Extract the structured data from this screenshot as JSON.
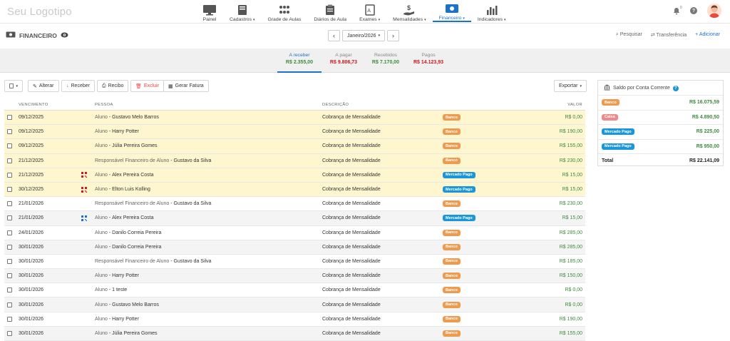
{
  "app": {
    "logo": "Seu Logotipo"
  },
  "nav": [
    {
      "label": "Painel",
      "icon": "monitor-icon",
      "caret": false,
      "active": false
    },
    {
      "label": "Cadastros",
      "icon": "book-icon",
      "caret": true,
      "active": false
    },
    {
      "label": "Grade de Aulas",
      "icon": "people-grid-icon",
      "caret": false,
      "active": false
    },
    {
      "label": "Diários de Aula",
      "icon": "clipboard-icon",
      "caret": false,
      "active": false
    },
    {
      "label": "Exames",
      "icon": "exam-icon",
      "caret": true,
      "active": false
    },
    {
      "label": "Mensalidades",
      "icon": "hand-money-icon",
      "caret": true,
      "active": false
    },
    {
      "label": "Financeiro",
      "icon": "banknote-icon",
      "caret": true,
      "active": true
    },
    {
      "label": "Indicadores",
      "icon": "bar-chart-icon",
      "caret": true,
      "active": false
    }
  ],
  "notifications": {
    "count": "0"
  },
  "page": {
    "title": "FINANCEIRO"
  },
  "month_selector": {
    "value": "Janeiro/2026",
    "prev": "‹",
    "next": "›"
  },
  "header_actions": {
    "search": "Pesquisar",
    "transfer": "Transferência",
    "add": "Adicionar"
  },
  "summary_tabs": [
    {
      "label": "A receber",
      "amount": "R$ 2.355,00",
      "color": "green",
      "active": true
    },
    {
      "label": "A pagar",
      "amount": "R$ 9.806,73",
      "color": "red",
      "active": false
    },
    {
      "label": "Recebidos",
      "amount": "R$ 7.170,00",
      "color": "green",
      "active": false
    },
    {
      "label": "Pagos",
      "amount": "R$ 14.123,93",
      "color": "red",
      "active": false
    }
  ],
  "toolbar": {
    "alter": "Alterar",
    "receive": "Receber",
    "receipt": "Recibo",
    "delete": "Excluir",
    "invoice": "Gerar Fatura",
    "export": "Exportar"
  },
  "table": {
    "headers": {
      "due": "VENCIMENTO",
      "person": "PESSOA",
      "description": "DESCRIÇÃO",
      "value": "VALOR"
    },
    "rows": [
      {
        "date": "09/12/2025",
        "role": "Aluno",
        "name": "Gustavo Melo Barros",
        "desc": "Cobrança de Mensalidade",
        "account": "Banco",
        "value": "R$ 0,00",
        "highlight": true,
        "qr": false
      },
      {
        "date": "09/12/2025",
        "role": "Aluno",
        "name": "Harry Potter",
        "desc": "Cobrança de Mensalidade",
        "account": "Banco",
        "value": "R$ 190,00",
        "highlight": true,
        "qr": false
      },
      {
        "date": "09/12/2025",
        "role": "Aluno",
        "name": "Júlia Pereira Gomes",
        "desc": "Cobrança de Mensalidade",
        "account": "Banco",
        "value": "R$ 155,00",
        "highlight": true,
        "qr": false
      },
      {
        "date": "21/12/2025",
        "role": "Responsável Financeiro de Aluno",
        "name": "Gustavo da Silva",
        "desc": "Cobrança de Mensalidade",
        "account": "Banco",
        "value": "R$ 230,00",
        "highlight": true,
        "qr": false
      },
      {
        "date": "21/12/2025",
        "role": "Aluno",
        "name": "Alex Pereira Costa",
        "desc": "Cobrança de Mensalidade",
        "account": "Mercado Pago",
        "value": "R$ 15,00",
        "highlight": true,
        "qr": true
      },
      {
        "date": "30/12/2025",
        "role": "Aluno",
        "name": "Elton Luis Kolling",
        "desc": "Cobrança de Mensalidade",
        "account": "Mercado Pago",
        "value": "R$ 15,00",
        "highlight": true,
        "qr": true
      },
      {
        "date": "21/01/2026",
        "role": "Responsável Financeiro de Aluno",
        "name": "Gustavo da Silva",
        "desc": "Cobrança de Mensalidade",
        "account": "Banco",
        "value": "R$ 230,00",
        "highlight": false,
        "qr": false
      },
      {
        "date": "21/01/2026",
        "role": "Aluno",
        "name": "Alex Pereira Costa",
        "desc": "Cobrança de Mensalidade",
        "account": "Mercado Pago",
        "value": "R$ 15,00",
        "highlight": false,
        "qr": true
      },
      {
        "date": "24/01/2026",
        "role": "Aluno",
        "name": "Danilo Correia Pereira",
        "desc": "Cobrança de Mensalidade",
        "account": "Banco",
        "value": "R$ 285,00",
        "highlight": false,
        "qr": false
      },
      {
        "date": "30/01/2026",
        "role": "Aluno",
        "name": "Danilo Correia Pereira",
        "desc": "Cobrança de Mensalidade",
        "account": "Banco",
        "value": "R$ 285,00",
        "highlight": false,
        "qr": false
      },
      {
        "date": "30/01/2026",
        "role": "Responsável Financeiro de Aluno",
        "name": "Gustavo da Silva",
        "desc": "Cobrança de Mensalidade",
        "account": "Banco",
        "value": "R$ 185,00",
        "highlight": false,
        "qr": false
      },
      {
        "date": "30/01/2026",
        "role": "Aluno",
        "name": "Harry Potter",
        "desc": "Cobrança de Mensalidade",
        "account": "Banco",
        "value": "R$ 150,00",
        "highlight": false,
        "qr": false
      },
      {
        "date": "30/01/2026",
        "role": "Aluno",
        "name": "1 teste",
        "desc": "Cobrança de Mensalidade",
        "account": "Banco",
        "value": "R$ 0,00",
        "highlight": false,
        "qr": false
      },
      {
        "date": "30/01/2026",
        "role": "Aluno",
        "name": "Gustavo Melo Barros",
        "desc": "Cobrança de Mensalidade",
        "account": "Banco",
        "value": "R$ 0,00",
        "highlight": false,
        "qr": false
      },
      {
        "date": "30/01/2026",
        "role": "Aluno",
        "name": "Harry Potter",
        "desc": "Cobrança de Mensalidade",
        "account": "Banco",
        "value": "R$ 190,00",
        "highlight": false,
        "qr": false
      },
      {
        "date": "30/01/2026",
        "role": "Aluno",
        "name": "Júlia Pereira Gomes",
        "desc": "Cobrança de Mensalidade",
        "account": "Banco",
        "value": "R$ 155,00",
        "highlight": false,
        "qr": false
      }
    ]
  },
  "balance": {
    "title": "Saldo por Conta Corrente",
    "accounts": [
      {
        "name": "Banco",
        "value": "R$ 16.075,59",
        "color": "#ef9b4f"
      },
      {
        "name": "Caixa",
        "value": "R$ 4.890,50",
        "color": "#ef8a8a"
      },
      {
        "name": "Mercado Pago",
        "value": "R$ 225,00",
        "color": "#1a96d9"
      },
      {
        "name": "Mercado Pago",
        "value": "R$ 950,00",
        "color": "#1a96d9"
      }
    ],
    "total_label": "Total",
    "total_value": "R$ 22.141,09"
  },
  "colors": {
    "accent": "#1a73c9",
    "green": "#3f8a3f",
    "red": "#d0161f",
    "highlight_row": "#fdf6cf"
  }
}
